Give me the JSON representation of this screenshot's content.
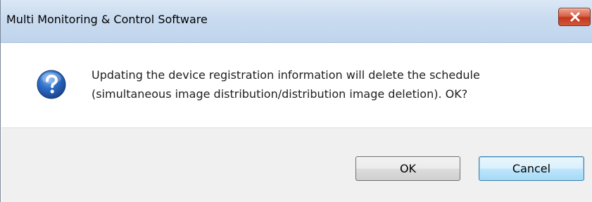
{
  "dialog": {
    "title": "Multi Monitoring & Control Software",
    "close_icon": "close-x-icon",
    "message_icon": "question-mark-icon",
    "message_line1": "Updating the device registration information will delete the schedule",
    "message_line2": "(simultaneous image distribution/distribution image deletion). OK?",
    "buttons": {
      "ok_label": "OK",
      "cancel_label": "Cancel"
    },
    "colors": {
      "close_button": "#c74b30",
      "icon_blue": "#2a5fb0",
      "default_button_border": "#3c7fb1",
      "footer_background": "#f0f0f0"
    }
  }
}
